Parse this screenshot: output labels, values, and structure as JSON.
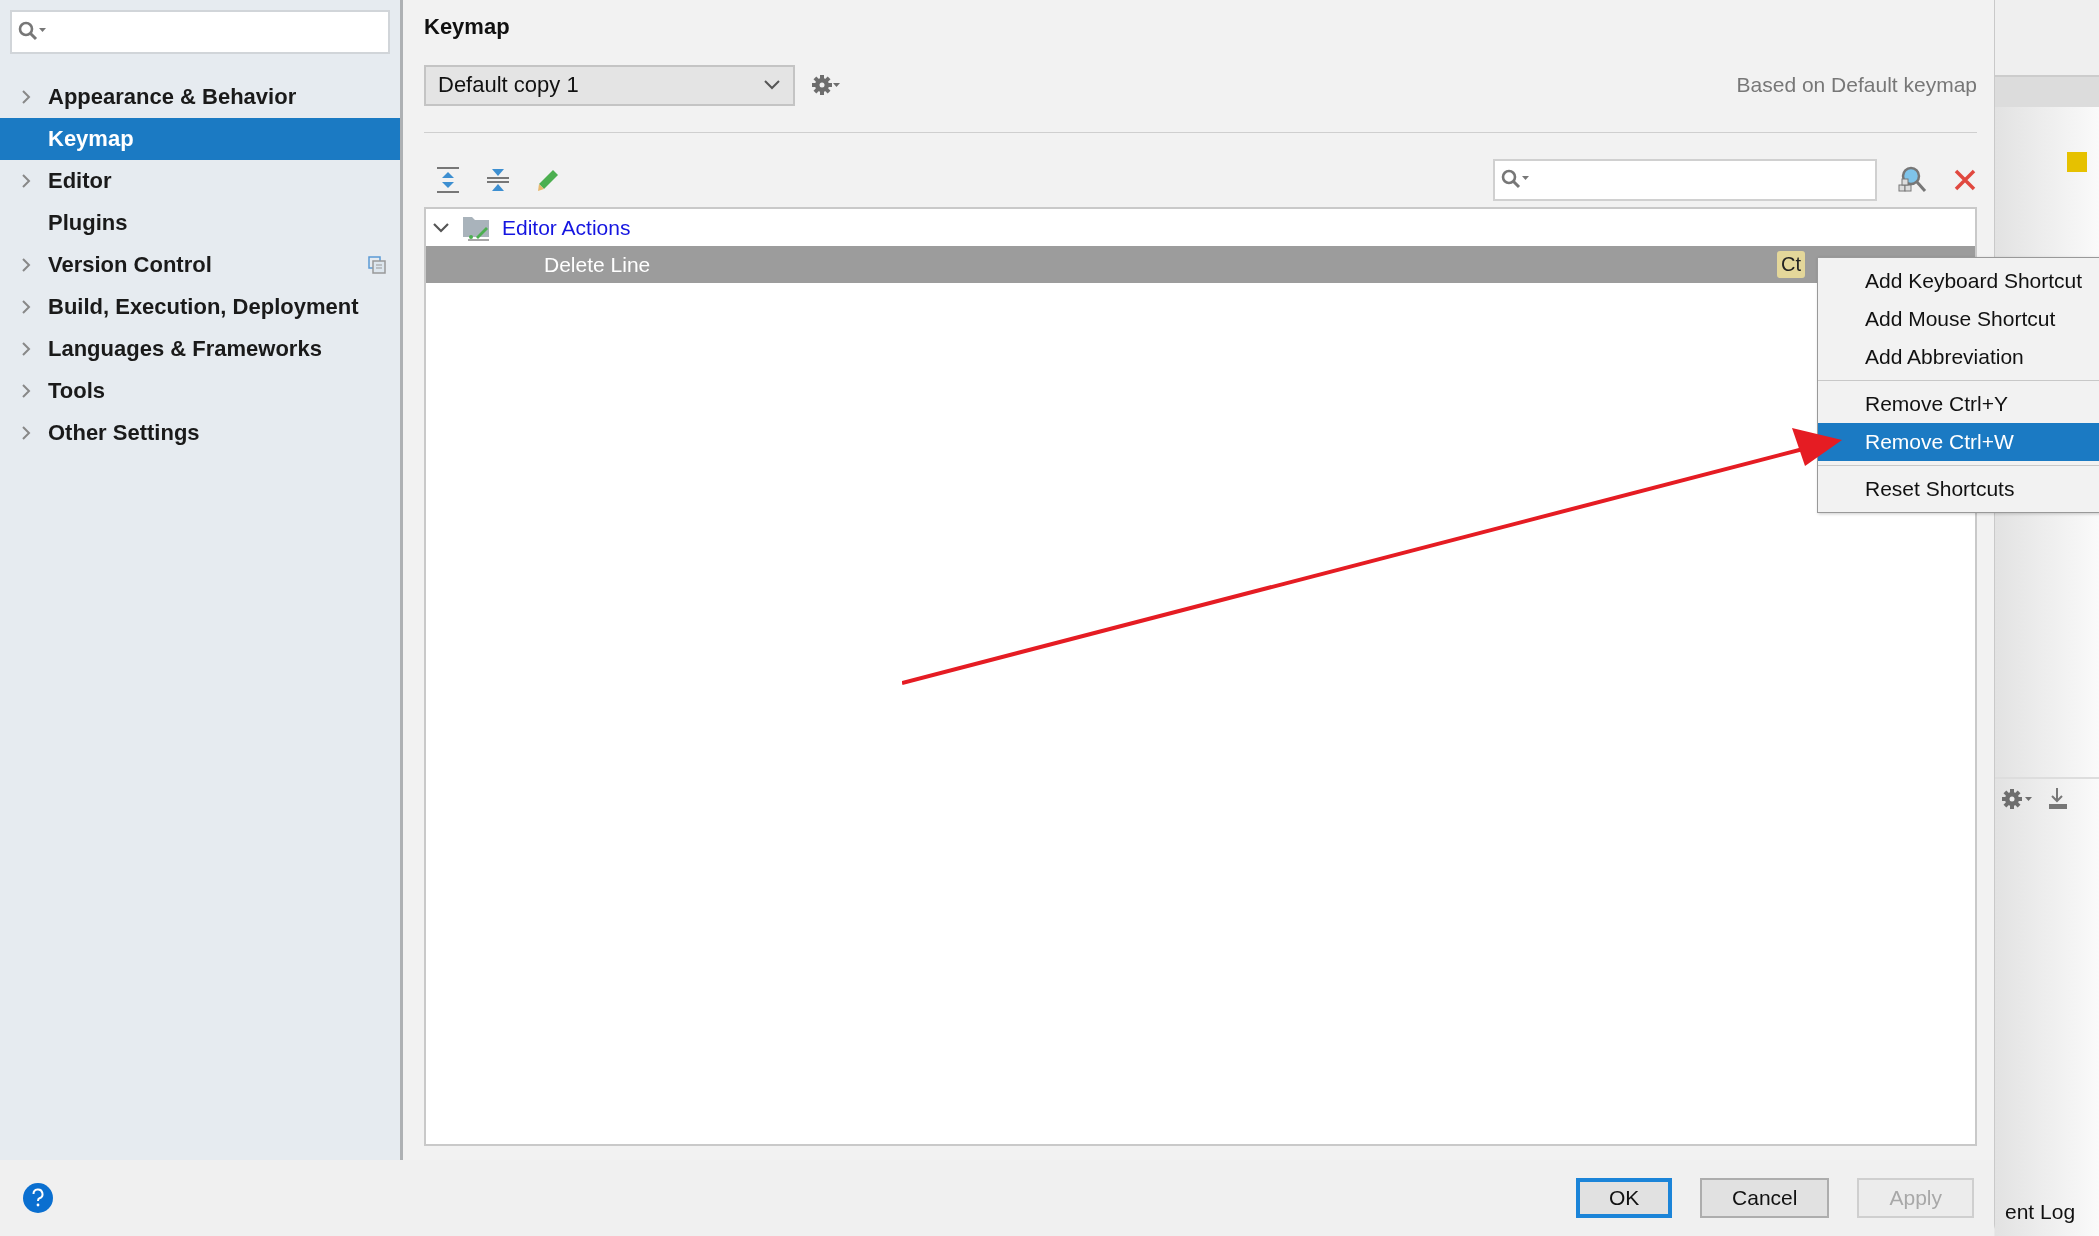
{
  "sidebar": {
    "items": [
      {
        "label": "Appearance & Behavior",
        "expandable": true,
        "selected": false,
        "project_icon": false
      },
      {
        "label": "Keymap",
        "expandable": false,
        "selected": true,
        "project_icon": false
      },
      {
        "label": "Editor",
        "expandable": true,
        "selected": false,
        "project_icon": false
      },
      {
        "label": "Plugins",
        "expandable": false,
        "selected": false,
        "project_icon": false
      },
      {
        "label": "Version Control",
        "expandable": true,
        "selected": false,
        "project_icon": true
      },
      {
        "label": "Build, Execution, Deployment",
        "expandable": true,
        "selected": false,
        "project_icon": false
      },
      {
        "label": "Languages & Frameworks",
        "expandable": true,
        "selected": false,
        "project_icon": false
      },
      {
        "label": "Tools",
        "expandable": true,
        "selected": false,
        "project_icon": false
      },
      {
        "label": "Other Settings",
        "expandable": true,
        "selected": false,
        "project_icon": false
      }
    ]
  },
  "page": {
    "title": "Keymap",
    "keymap_select": {
      "value": "Default copy 1"
    },
    "based_on": "Based on Default keymap"
  },
  "tree": {
    "rows": [
      {
        "label": "Editor Actions",
        "kind": "group",
        "expanded": true,
        "selected": false,
        "children": [
          {
            "label": "Delete Line",
            "kind": "action",
            "selected": true,
            "shortcuts": [
              "Ct"
            ]
          }
        ]
      }
    ]
  },
  "context_menu": {
    "groups": [
      {
        "items": [
          {
            "label": "Add Keyboard Shortcut",
            "selected": false
          },
          {
            "label": "Add Mouse Shortcut",
            "selected": false
          },
          {
            "label": "Add Abbreviation",
            "selected": false
          }
        ]
      },
      {
        "items": [
          {
            "label": "Remove Ctrl+Y",
            "selected": false
          },
          {
            "label": "Remove Ctrl+W",
            "selected": true
          }
        ]
      },
      {
        "items": [
          {
            "label": "Reset Shortcuts",
            "selected": false
          }
        ]
      }
    ]
  },
  "buttons": [
    {
      "label": "OK",
      "kind": "default",
      "disabled": false
    },
    {
      "label": "Cancel",
      "kind": "normal",
      "disabled": false
    },
    {
      "label": "Apply",
      "kind": "normal",
      "disabled": true
    }
  ],
  "background_ide": {
    "status_text": "ent Log"
  }
}
